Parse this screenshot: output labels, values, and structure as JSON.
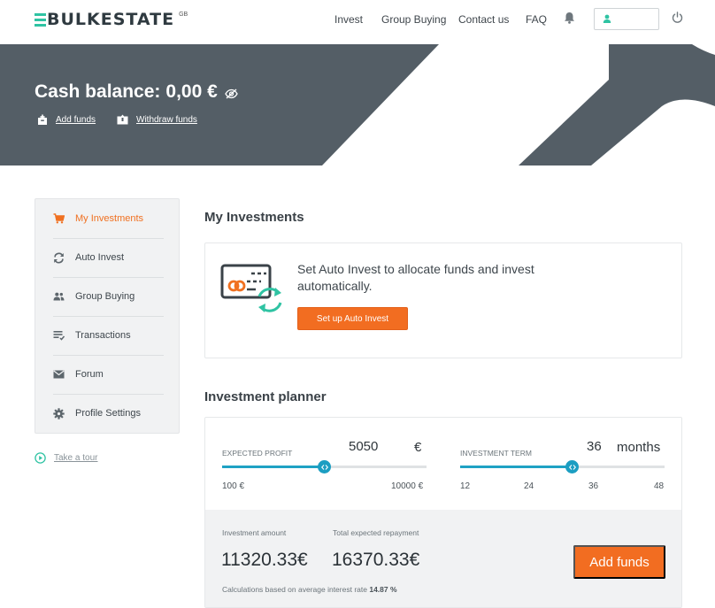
{
  "brand": {
    "name": "BULKESTATE",
    "country": "GB",
    "accent": "#2fc3a3"
  },
  "nav": {
    "items": [
      "Invest",
      "Group Buying",
      "Contact us",
      "FAQ"
    ],
    "bell_icon": "bell-icon",
    "user_icon": "user-icon",
    "power_icon": "power-icon"
  },
  "hero": {
    "balance_label": "Cash balance:",
    "balance_value": "0,00 €",
    "add_funds": "Add funds",
    "withdraw_funds": "Withdraw funds",
    "bg_color": "#545e66"
  },
  "sidebar": {
    "items": [
      {
        "label": "My Investments",
        "icon": "cart-icon",
        "active": true
      },
      {
        "label": "Auto Invest",
        "icon": "refresh-icon",
        "active": false
      },
      {
        "label": "Group Buying",
        "icon": "group-icon",
        "active": false
      },
      {
        "label": "Transactions",
        "icon": "transactions-icon",
        "active": false
      },
      {
        "label": "Forum",
        "icon": "mail-icon",
        "active": false
      },
      {
        "label": "Profile Settings",
        "icon": "gear-icon",
        "active": false
      }
    ],
    "tour": "Take a tour"
  },
  "main": {
    "title": "My Investments",
    "auto_invest": {
      "text": "Set Auto Invest to allocate funds and invest automatically.",
      "button": "Set up Auto Invest"
    },
    "planner": {
      "title": "Investment planner",
      "profit": {
        "label": "EXPECTED PROFIT",
        "value": "5050",
        "unit": "€",
        "min_label": "100 €",
        "max_label": "10000 €",
        "min": 100,
        "max": 10000,
        "current": 5050
      },
      "term": {
        "label": "INVESTMENT TERM",
        "value": "36",
        "unit": "months",
        "ticks": [
          "12",
          "24",
          "36",
          "48"
        ],
        "min": 12,
        "max": 48,
        "current": 36
      },
      "investment_amount_label": "Investment amount",
      "investment_amount": "11320.33€",
      "repayment_label": "Total expected repayment",
      "repayment": "16370.33€",
      "note": "Calculations based on average interest rate",
      "rate": "14.87 %",
      "add_funds_button": "Add funds"
    }
  },
  "colors": {
    "orange": "#f26d21",
    "slider": "#1c9ec2"
  }
}
